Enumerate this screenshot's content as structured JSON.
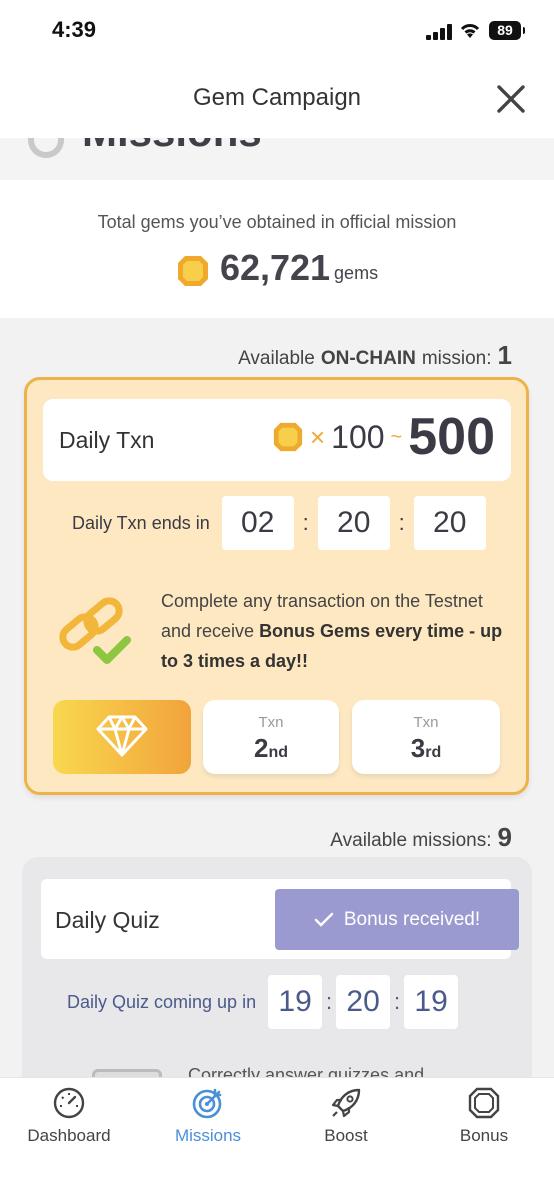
{
  "status": {
    "time": "4:39",
    "battery": "89"
  },
  "nav": {
    "title": "Gem Campaign"
  },
  "section_peek": {
    "title": "Missions"
  },
  "total": {
    "label": "Total gems you’ve obtained in official mission",
    "value": "62,721",
    "unit": "gems"
  },
  "onchain": {
    "prefix": "Available",
    "bold": "ON-CHAIN",
    "suffix": "mission:",
    "count": "1"
  },
  "daily_txn": {
    "name": "Daily Txn",
    "multiplier": "×",
    "min": "100",
    "tilde": "~",
    "max": "500",
    "timer_label": "Daily Txn ends in",
    "timer": [
      "02",
      "20",
      "20"
    ],
    "desc_plain": "Complete any transaction on the Testnet and receive ",
    "desc_bold": "Bonus Gems every time - up to 3 times a day!!",
    "slots": [
      {
        "top": "Txn",
        "num": "2",
        "suf": "nd"
      },
      {
        "top": "Txn",
        "num": "3",
        "suf": "rd"
      }
    ]
  },
  "available": {
    "label": "Available missions:",
    "count": "9"
  },
  "daily_quiz": {
    "name": "Daily Quiz",
    "button": "Bonus received!",
    "timer_label": "Daily Quiz coming up in",
    "timer": [
      "19",
      "20",
      "19"
    ],
    "desc": "Correctly answer quizzes and"
  },
  "tabs": [
    {
      "label": "Dashboard"
    },
    {
      "label": "Missions"
    },
    {
      "label": "Boost"
    },
    {
      "label": "Bonus"
    }
  ],
  "colors": {
    "accent": "#4a8fd8",
    "gold": "#eeb24a",
    "card": "#fde8c2",
    "quiz_button": "#9b9ad0"
  }
}
